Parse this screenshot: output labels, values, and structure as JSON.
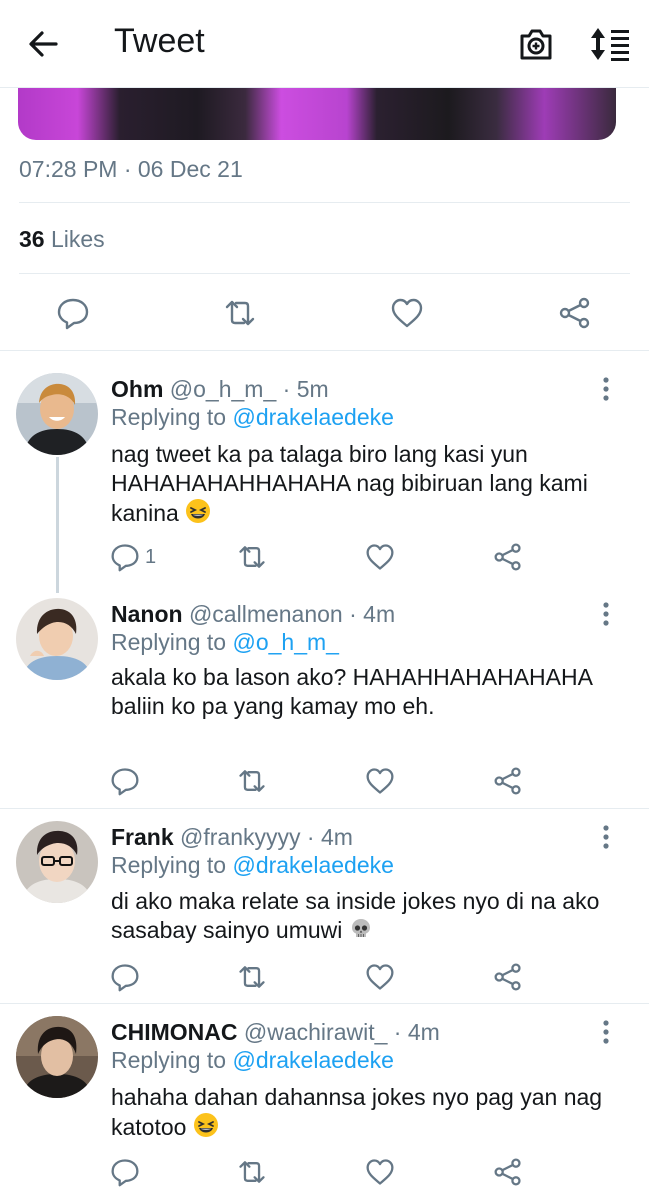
{
  "header": {
    "title": "Tweet",
    "back_icon": "arrow-left-icon",
    "camera_icon": "camera-add-icon",
    "sort_icon": "sort-icon"
  },
  "tweet": {
    "timestamp": "07:28 PM · 06 Dec 21",
    "likes_count": "36",
    "likes_label": "Likes"
  },
  "colors": {
    "accent": "#1da1f2",
    "secondary_text": "#657786",
    "divider": "#e6ecf0",
    "thread_line": "#ccd6dd"
  },
  "replies": [
    {
      "name": "Ohm",
      "handle": "@o_h_m_",
      "time": "· 5m",
      "replying_label": "Replying to",
      "replying_to": "@drakelaedeke",
      "text": "nag tweet ka pa talaga biro lang kasi yun HAHAHAHAHHAHAHA nag bibiruan lang kami kanina",
      "emoji": "grinning-squinting-face",
      "reply_count": "1"
    },
    {
      "name": "Nanon",
      "handle": "@callmenanon",
      "time": "· 4m",
      "replying_label": "Replying to",
      "replying_to": "@o_h_m_",
      "text": "akala ko ba lason ako? HAHAHHAHAHAHAHA baliin ko pa yang kamay mo eh.",
      "emoji": "",
      "reply_count": ""
    },
    {
      "name": "Frank",
      "handle": "@frankyyyy",
      "time": "· 4m",
      "replying_label": "Replying to",
      "replying_to": "@drakelaedeke",
      "text": "di ako maka relate sa inside jokes nyo di na ako sasabay sainyo umuwi",
      "emoji": "skull",
      "reply_count": ""
    },
    {
      "name": "CHIMONAC",
      "handle": "@wachirawit_",
      "time": "· 4m",
      "replying_label": "Replying to",
      "replying_to": "@drakelaedeke",
      "text": "hahaha dahan dahannsa jokes nyo pag yan nag katotoo",
      "emoji": "grinning-squinting-face",
      "reply_count": ""
    }
  ]
}
